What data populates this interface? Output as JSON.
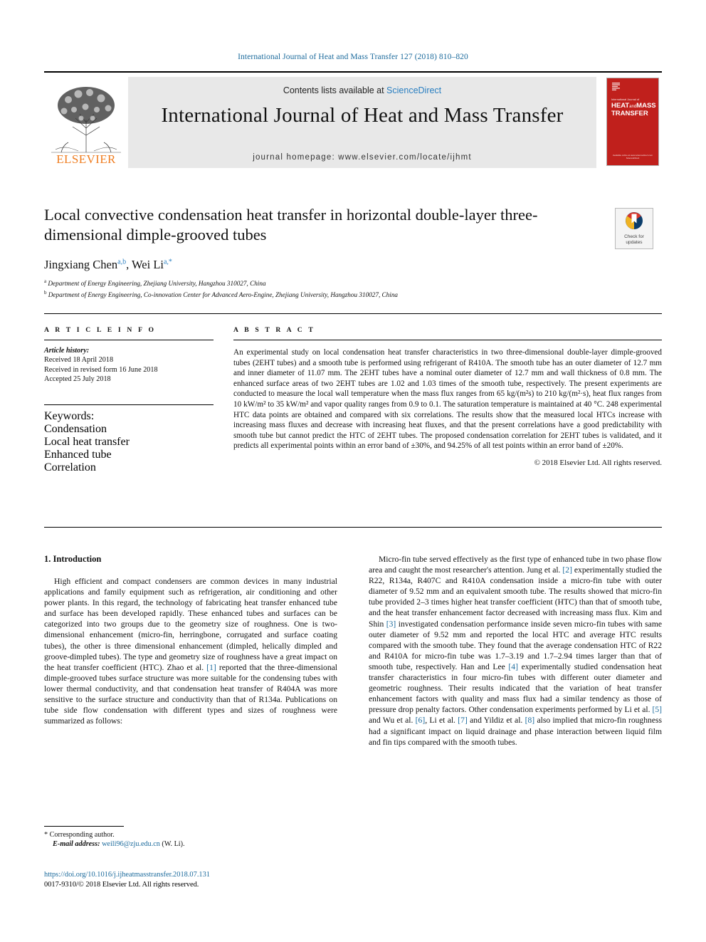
{
  "running_head": "International Journal of Heat and Mass Transfer 127 (2018) 810–820",
  "masthead": {
    "contents_prefix": "Contents lists available at ",
    "sciencedirect": "ScienceDirect",
    "journal_title": "International Journal of Heat and Mass Transfer",
    "homepage": "journal homepage: www.elsevier.com/locate/ijhmt",
    "publisher": "ELSEVIER",
    "cover": {
      "sub": "International Journal of",
      "main_1": "HEAT",
      "main_and": "and",
      "main_2": "MASS",
      "main_3": "TRANSFER",
      "foot": "Available online at www.sciencedirect.com\nScienceDirect"
    }
  },
  "article": {
    "title": "Local convective condensation heat transfer in horizontal double-layer three-dimensional dimple-grooved tubes",
    "authors": [
      {
        "name": "Jingxiang Chen",
        "sup": "a,b"
      },
      {
        "name": "Wei Li",
        "sup": "a,*"
      }
    ],
    "authors_separator": ", ",
    "affiliations": [
      {
        "sup": "a",
        "text": "Department of Energy Engineering, Zhejiang University, Hangzhou 310027, China"
      },
      {
        "sup": "b",
        "text": "Department of Energy Engineering, Co-innovation Center for Advanced Aero-Engine, Zhejiang University, Hangzhou 310027, China"
      }
    ],
    "crossmark": {
      "line1": "Check for",
      "line2": "updates"
    }
  },
  "info": {
    "heading": "A R T I C L E    I N F O",
    "history_label": "Article history:",
    "history": [
      "Received 18 April 2018",
      "Received in revised form 16 June 2018",
      "Accepted 25 July 2018"
    ],
    "keywords_label": "Keywords:",
    "keywords": [
      "Condensation",
      "Local heat transfer",
      "Enhanced tube",
      "Correlation"
    ]
  },
  "abstract": {
    "heading": "A B S T R A C T",
    "text": "An experimental study on local condensation heat transfer characteristics in two three-dimensional double-layer dimple-grooved tubes (2EHT tubes) and a smooth tube is performed using refrigerant of R410A. The smooth tube has an outer diameter of 12.7 mm and inner diameter of 11.07 mm. The 2EHT tubes have a nominal outer diameter of 12.7 mm and wall thickness of 0.8 mm. The enhanced surface areas of two 2EHT tubes are 1.02 and 1.03 times of the smooth tube, respectively. The present experiments are conducted to measure the local wall temperature when the mass flux ranges from 65 kg/(m²s) to 210 kg/(m²·s), heat flux ranges from 10 kW/m² to 35 kW/m² and vapor quality ranges from 0.9 to 0.1. The saturation temperature is maintained at 40 °C. 248 experimental HTC data points are obtained and compared with six correlations. The results show that the measured local HTCs increase with increasing mass fluxes and decrease with increasing heat fluxes, and that the present correlations have a good predictability with smooth tube but cannot predict the HTC of 2EHT tubes. The proposed condensation correlation for 2EHT tubes is validated, and it predicts all experimental points within an error band of ±30%, and 94.25% of all test points within an error band of ±20%.",
    "copyright": "© 2018 Elsevier Ltd. All rights reserved."
  },
  "body": {
    "section_number_title": "1. Introduction",
    "left_paragraphs": [
      "High efficient and compact condensers are common devices in many industrial applications and family equipment such as refrigeration, air conditioning and other power plants. In this regard, the technology of fabricating heat transfer enhanced tube and surface has been developed rapidly. These enhanced tubes and surfaces can be categorized into two groups due to the geometry size of roughness. One is two-dimensional enhancement (micro-fin, herringbone, corrugated and surface coating tubes), the other is three dimensional enhancement (dimpled, helically dimpled and groove-dimpled tubes). The type and geometry size of roughness have a great impact on the heat transfer coefficient (HTC). Zhao et al. [1] reported that the three-dimensional dimple-grooved tubes surface structure was more suitable for the condensing tubes with lower thermal conductivity, and that condensation heat transfer of R404A was more sensitive to the surface structure and conductivity than that of R134a. Publications on tube side flow condensation with different types and sizes of roughness were summarized as follows:"
    ],
    "right_paragraphs": [
      "Micro-fin tube served effectively as the first type of enhanced tube in two phase flow area and caught the most researcher's attention. Jung et al. [2] experimentally studied the R22, R134a, R407C and R410A condensation inside a micro-fin tube with outer diameter of 9.52 mm and an equivalent smooth tube. The results showed that micro-fin tube provided 2–3 times higher heat transfer coefficient (HTC) than that of smooth tube, and the heat transfer enhancement factor decreased with increasing mass flux. Kim and Shin [3] investigated condensation performance inside seven micro-fin tubes with same outer diameter of 9.52 mm and reported the local HTC and average HTC results compared with the smooth tube. They found that the average condensation HTC of R22 and R410A for micro-fin tube was 1.7–3.19 and 1.7–2.94 times larger than that of smooth tube, respectively. Han and Lee [4] experimentally studied condensation heat transfer characteristics in four micro-fin tubes with different outer diameter and geometric roughness. Their results indicated that the variation of heat transfer enhancement factors with quality and mass flux had a similar tendency as those of pressure drop penalty factors. Other condensation experiments performed by Li et al. [5] and Wu et al. [6], Li et al. [7] and Yildiz et al. [8] also implied that micro-fin roughness had a significant impact on liquid drainage and phase interaction between liquid film and fin tips compared with the smooth tubes."
    ]
  },
  "footnote": {
    "corresponding": "* Corresponding author.",
    "email_label": "E-mail address:",
    "email": "weili96@zju.edu.cn",
    "email_suffix": "(W. Li)."
  },
  "footer": {
    "doi": "https://doi.org/10.1016/j.ijheatmasstransfer.2018.07.131",
    "issn_line": "0017-9310/© 2018 Elsevier Ltd. All rights reserved."
  },
  "colors": {
    "link": "#1b6a9c",
    "sciencedirect": "#2a7fc1",
    "elsevier_orange": "#ef7d20",
    "cover_red": "#c0201c",
    "masthead_gray": "#e8e8e8"
  }
}
